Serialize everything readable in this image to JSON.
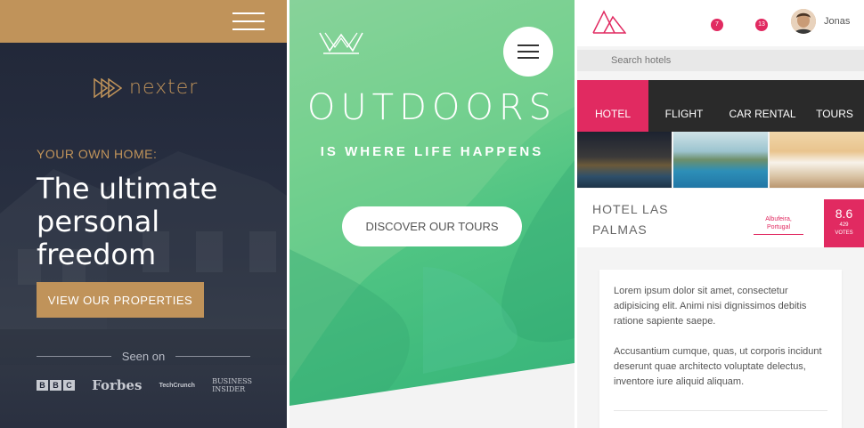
{
  "nexter": {
    "logo_text": "nexter",
    "kicker": "YOUR OWN HOME:",
    "title": "The ultimate personal freedom",
    "cta_label": "VIEW OUR PROPERTIES",
    "seen_on_label": "Seen on",
    "brands": {
      "bbc": [
        "B",
        "B",
        "C"
      ],
      "forbes": "Forbes",
      "techcrunch": "TechCrunch",
      "business_insider_line1": "Business",
      "business_insider_line2": "Insider"
    },
    "colors": {
      "accent": "#c0935a",
      "background": "#1f2536"
    }
  },
  "outdoors": {
    "title": "OUTDOORS",
    "subtitle": "IS WHERE LIFE HAPPENS",
    "cta_label": "DISCOVER OUR TOURS",
    "colors": {
      "green": "#4fc483"
    }
  },
  "hotels": {
    "notifications": {
      "badge1": "7",
      "badge2": "13"
    },
    "user_name": "Jonas",
    "search_placeholder": "Search hotels",
    "tabs": [
      {
        "label": "HOTEL",
        "active": true
      },
      {
        "label": "FLIGHT",
        "active": false
      },
      {
        "label": "CAR RENTAL",
        "active": false
      },
      {
        "label": "TOURS",
        "active": false
      }
    ],
    "hotel_name": "HOTEL LAS PALMAS",
    "location_line1": "Albufeira,",
    "location_line2": "Portugal",
    "rating": "8.6",
    "votes_line1": "429",
    "votes_line2": "VOTES",
    "paragraph1": "Lorem ipsum dolor sit amet, consectetur adipisicing elit. Animi nisi dignissimos debitis ratione sapiente saepe.",
    "paragraph2": "Accusantium cumque, quas, ut corporis incidunt deserunt quae architecto voluptate delectus, inventore iure aliquid aliquam.",
    "colors": {
      "accent": "#e12a61",
      "tabbar": "#2a2a2a"
    }
  }
}
